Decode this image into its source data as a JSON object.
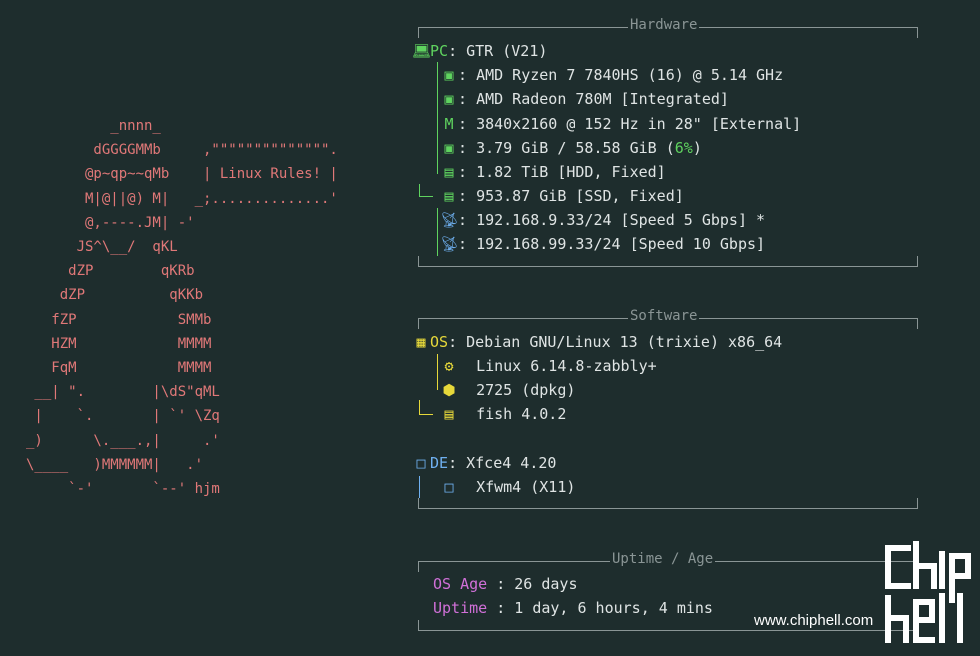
{
  "ascii_art": [
    "          _nnnn_",
    "        dGGGGMMb     ,\"\"\"\"\"\"\"\"\"\"\"\"\"\".",
    "       @p~qp~~qMb    | Linux Rules! |",
    "       M|@||@) M|   _;..............'",
    "       @,----.JM| -'",
    "      JS^\\__/  qKL",
    "     dZP        qKRb",
    "    dZP          qKKb",
    "   fZP            SMMb",
    "   HZM            MMMM",
    "   FqM            MMMM",
    " __| \".        |\\dS\"qML",
    " |    `.       | `' \\Zq",
    "_)      \\.___.,|     .'",
    "\\____   )MMMMMM|   .'",
    "     `-'       `--' hjm"
  ],
  "hardware": {
    "title": "Hardware",
    "pc_key": "PC",
    "pc_value": "GTR (V21)",
    "cpu": "AMD Ryzen 7 7840HS (16) @ 5.14 GHz",
    "gpu": "AMD Radeon 780M [Integrated]",
    "display": "3840x2160 @ 152 Hz in 28\" [External]",
    "memory_prefix": "3.79 GiB / 58.58 GiB (",
    "memory_pct": "6%",
    "memory_suffix": ")",
    "disk1": "1.82 TiB [HDD, Fixed]",
    "disk2": "953.87 GiB [SSD, Fixed]",
    "net1": "192.168.9.33/24 [Speed 5 Gbps] *",
    "net2": "192.168.99.33/24 [Speed 10 Gbps]"
  },
  "software": {
    "title": "Software",
    "os_key": "OS",
    "os_value": "Debian GNU/Linux 13 (trixie) x86_64",
    "kernel": "Linux 6.14.8-zabbly+",
    "packages": "2725 (dpkg)",
    "shell": "fish 4.0.2",
    "de_key": "DE",
    "de_value": "Xfce4 4.20",
    "wm": "Xfwm4 (X11)"
  },
  "uptime": {
    "title": "Uptime / Age",
    "os_age_key": "OS Age",
    "os_age_value": "26 days",
    "uptime_key": "Uptime",
    "uptime_value": "1 day, 6 hours, 4 mins"
  },
  "watermark": {
    "logo_text": "chiphell",
    "site": "www.chiphell.com"
  },
  "colors": {
    "background": "#1e2d2d",
    "hardware_accent": "#5fd35f",
    "software_accent": "#e6d83a",
    "de_accent": "#6fb0f0",
    "uptime_key": "#d070d8",
    "ascii": "#e07878"
  },
  "icons": {
    "pc": "laptop-icon",
    "cpu": "chip-icon",
    "gpu": "gpu-icon",
    "display": "monitor-icon",
    "memory": "memory-icon",
    "disk": "terminal-disk-icon",
    "net": "satellite-icon",
    "os": "windows-grid-icon",
    "kernel": "gear-icon",
    "packages": "package-icon",
    "shell": "terminal-icon",
    "de": "window-icon",
    "wm": "window-icon"
  }
}
